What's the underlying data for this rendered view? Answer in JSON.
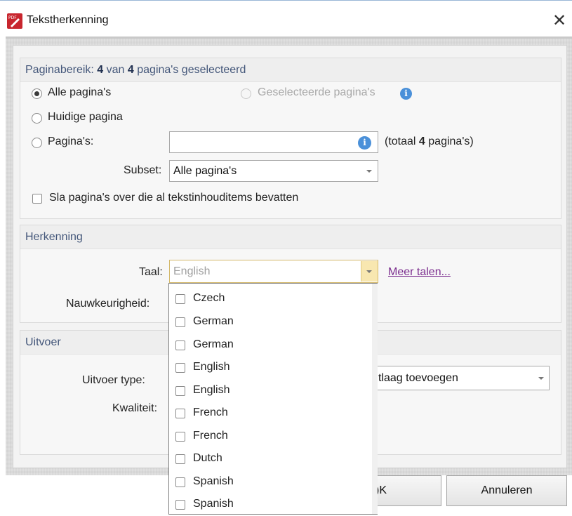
{
  "window": {
    "title": "Tekstherkenning",
    "close_glyph": "✕",
    "icon": "pdf-app-icon"
  },
  "page_range": {
    "header_prefix": "Paginabereik: ",
    "selected_count": "4",
    "header_mid": " van ",
    "total_count": "4",
    "header_suffix": " pagina's geselecteerd",
    "opt_all": "Alle pagina's",
    "opt_selected": "Geselecteerde pagina's",
    "opt_current": "Huidige pagina",
    "opt_pages": "Pagina's:",
    "pages_input_value": "",
    "total_prefix": "(totaal ",
    "total_value": "4",
    "total_suffix": " pagina's)",
    "subset_label": "Subset:",
    "subset_value": "Alle pagina's",
    "skip_label": "Sla pagina's over die al tekstinhouditems bevatten"
  },
  "recognition": {
    "header": "Herkenning",
    "language_label": "Taal:",
    "language_value": "English",
    "more_languages": "Meer talen...",
    "accuracy_label": "Nauwkeurigheid:"
  },
  "output": {
    "header": "Uitvoer",
    "type_label": "Uitvoer type:",
    "type_value_visible": "tlaag toevoegen",
    "quality_label": "Kwaliteit:"
  },
  "languages": [
    "Czech",
    "German",
    "German",
    "English",
    "English",
    "French",
    "French",
    "Dutch",
    "Spanish",
    "Spanish"
  ],
  "buttons": {
    "ok": "OK",
    "ok_visible": ")K",
    "cancel": "Annuleren"
  },
  "colors": {
    "accent_link": "#7b2d8e",
    "info_blue": "#4a90d9",
    "section_head_text": "#44577a"
  }
}
